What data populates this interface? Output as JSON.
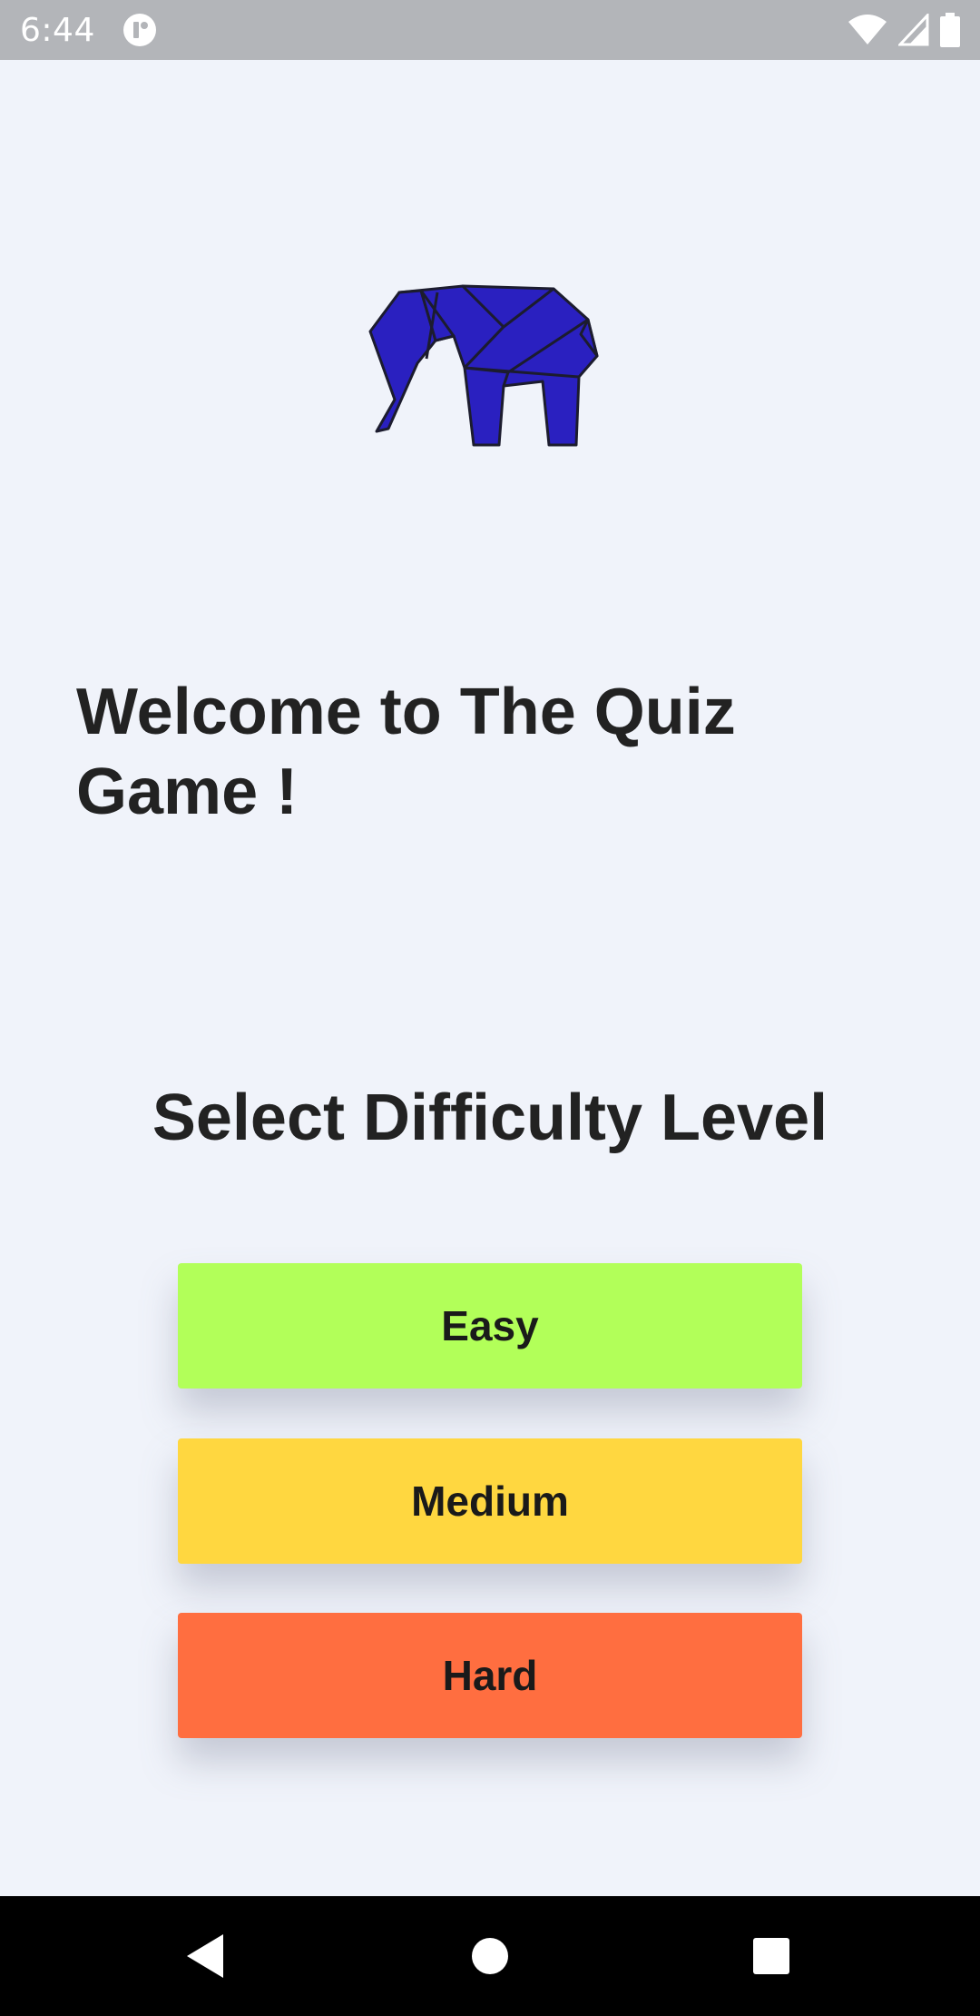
{
  "status_bar": {
    "time": "6:44",
    "icons": [
      "app-notification-icon",
      "wifi-icon",
      "cell-signal-icon",
      "battery-icon"
    ]
  },
  "logo": {
    "icon": "origami-elephant-icon",
    "color": "#2a20c0"
  },
  "welcome_text": "Welcome to The Quiz Game !",
  "select_title": "Select Difficulty Level",
  "levels": [
    {
      "label": "Easy",
      "color": "#b2ff59"
    },
    {
      "label": "Medium",
      "color": "#ffd740"
    },
    {
      "label": "Hard",
      "color": "#ff6e40"
    }
  ],
  "nav_bar": {
    "icons": [
      "back-icon",
      "home-icon",
      "recents-icon"
    ]
  }
}
